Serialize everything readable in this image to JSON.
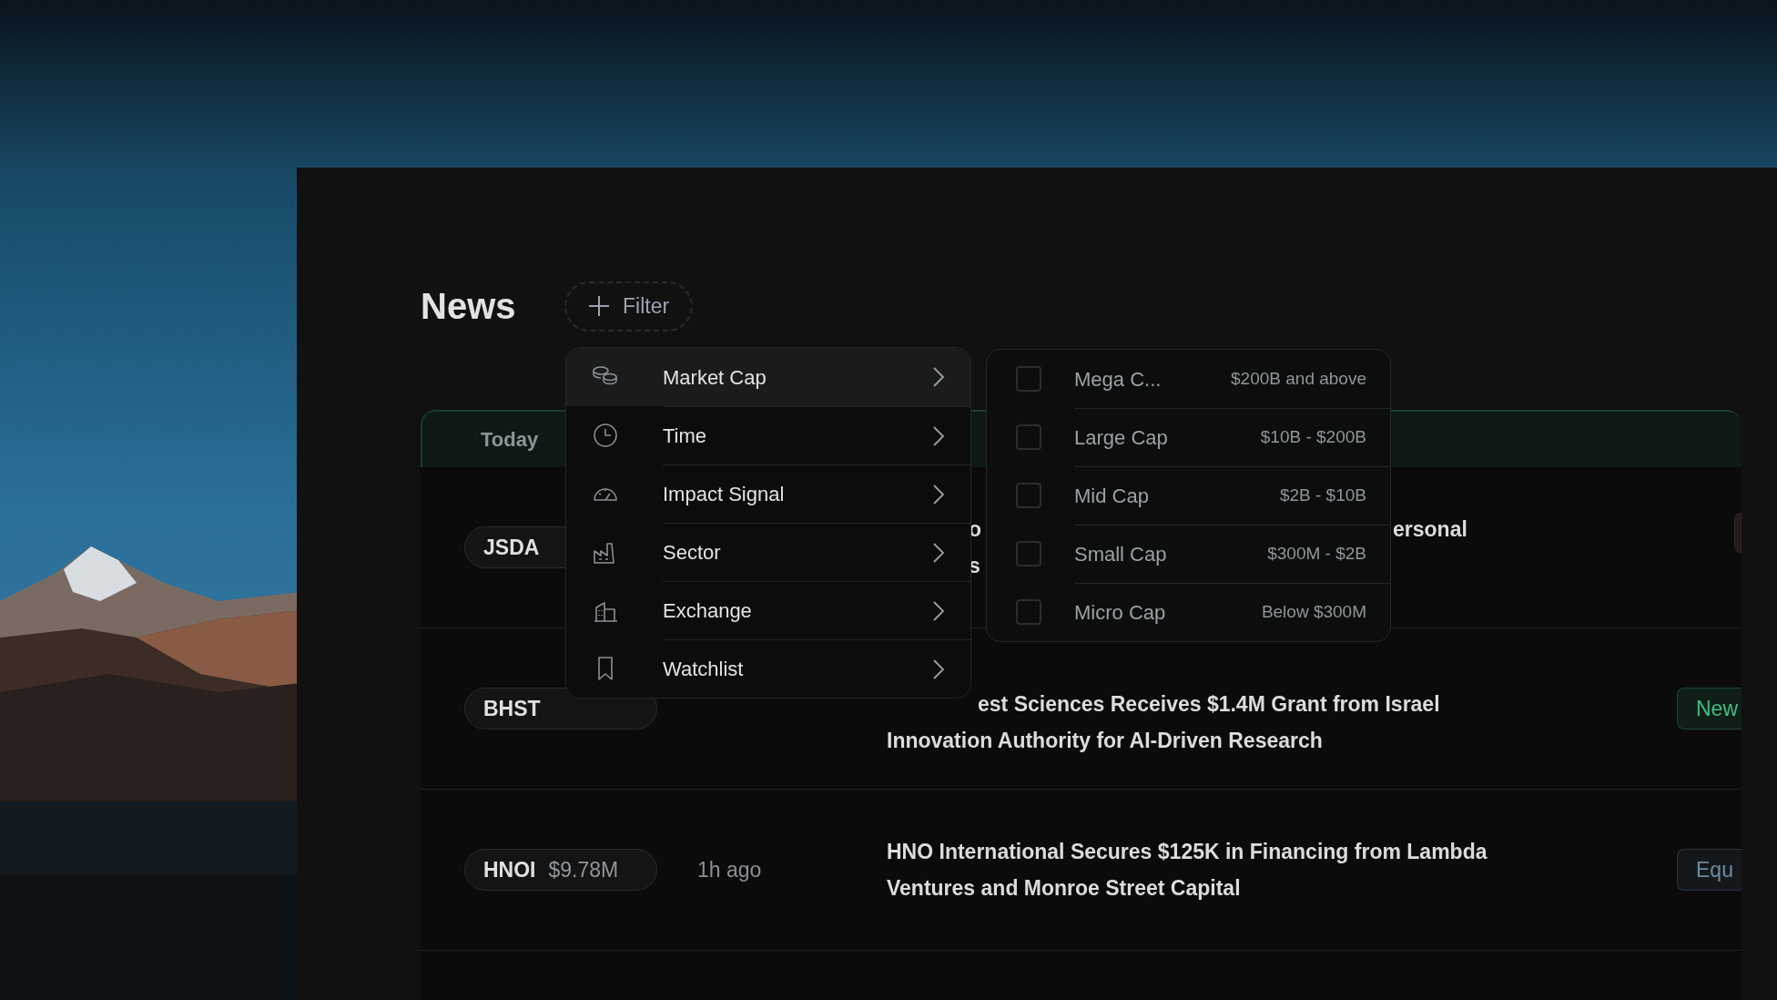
{
  "page": {
    "title": "News",
    "filter_button": "Filter"
  },
  "table": {
    "header": "Today",
    "rows": [
      {
        "ticker": "JSDA",
        "headline_fragments": [
          [
            "o",
            "ersonal"
          ],
          [
            "s"
          ]
        ],
        "tag": {
          "color": "#3a2626"
        }
      },
      {
        "ticker": "BHST",
        "headline_lines": [
          "est Sciences Receives $1.4M Grant from Israel",
          "Innovation Authority for AI-Driven Research"
        ],
        "tag": {
          "text": "New",
          "color": "#3fbf85"
        }
      },
      {
        "ticker": "HNOI",
        "price": "$9.78M",
        "time": "1h ago",
        "headline_lines": [
          "HNO International Secures $125K in Financing from Lambda",
          "Ventures and Monroe Street Capital"
        ],
        "tag": {
          "text": "Equ",
          "color": "#6b8ca0"
        }
      }
    ]
  },
  "filter_menu": [
    {
      "label": "Market Cap",
      "selected": true
    },
    {
      "label": "Time",
      "selected": false
    },
    {
      "label": "Impact Signal",
      "selected": false
    },
    {
      "label": "Sector",
      "selected": false
    },
    {
      "label": "Exchange",
      "selected": false
    },
    {
      "label": "Watchlist",
      "selected": false
    }
  ],
  "submenu": [
    {
      "label": "Mega C...",
      "range": "$200B and above",
      "checked": false
    },
    {
      "label": "Large Cap",
      "range": "$10B - $200B",
      "checked": false
    },
    {
      "label": "Mid Cap",
      "range": "$2B - $10B",
      "checked": false
    },
    {
      "label": "Small Cap",
      "range": "$300M - $2B",
      "checked": false
    },
    {
      "label": "Micro Cap",
      "range": "Below $300M",
      "checked": false
    }
  ]
}
